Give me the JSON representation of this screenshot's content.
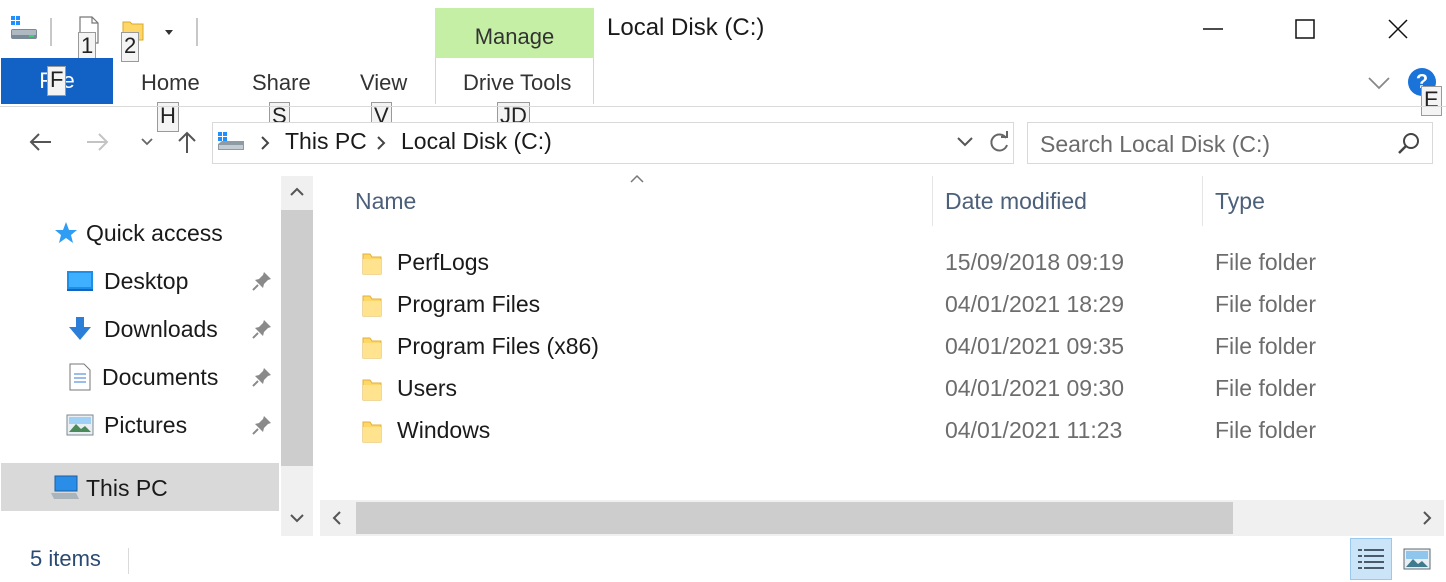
{
  "window": {
    "title": "Local Disk (C:)",
    "contextual_group": "Manage",
    "buttons": {
      "minimize": "minimize-icon",
      "maximize": "maximize-icon",
      "close": "close-icon"
    }
  },
  "quick_access_toolbar": {
    "keytips": [
      "1",
      "2"
    ]
  },
  "ribbon": {
    "file_tab": "File",
    "file_keytip": "F",
    "tabs": [
      {
        "label": "Home",
        "keytip": "H"
      },
      {
        "label": "Share",
        "keytip": "S"
      },
      {
        "label": "View",
        "keytip": "V"
      },
      {
        "label": "Drive Tools",
        "keytip": "JD"
      }
    ],
    "help_label": "?",
    "help_keytip": "E"
  },
  "navigation": {
    "breadcrumb": [
      "This PC",
      "Local Disk (C:)"
    ],
    "search_placeholder": "Search Local Disk (C:)"
  },
  "sidebar": {
    "items": [
      {
        "label": "Quick access",
        "icon": "star-icon"
      },
      {
        "label": "Desktop",
        "icon": "desktop-icon",
        "pinned": true
      },
      {
        "label": "Downloads",
        "icon": "download-arrow-icon",
        "pinned": true
      },
      {
        "label": "Documents",
        "icon": "document-icon",
        "pinned": true
      },
      {
        "label": "Pictures",
        "icon": "pictures-icon",
        "pinned": true
      },
      {
        "label": "This PC",
        "icon": "computer-icon",
        "selected": true
      }
    ]
  },
  "file_list": {
    "columns": [
      "Name",
      "Date modified",
      "Type"
    ],
    "rows": [
      {
        "name": "PerfLogs",
        "date": "15/09/2018 09:19",
        "type": "File folder"
      },
      {
        "name": "Program Files",
        "date": "04/01/2021 18:29",
        "type": "File folder"
      },
      {
        "name": "Program Files (x86)",
        "date": "04/01/2021 09:35",
        "type": "File folder"
      },
      {
        "name": "Users",
        "date": "04/01/2021 09:30",
        "type": "File folder"
      },
      {
        "name": "Windows",
        "date": "04/01/2021 11:23",
        "type": "File folder"
      }
    ]
  },
  "status_bar": {
    "item_count": "5 items"
  },
  "colors": {
    "file_tab": "#1261c4",
    "manage_tab": "#c6efa6",
    "folder": "#ffd766",
    "selected": "#d9d9d9",
    "header_text": "#4c607a"
  }
}
